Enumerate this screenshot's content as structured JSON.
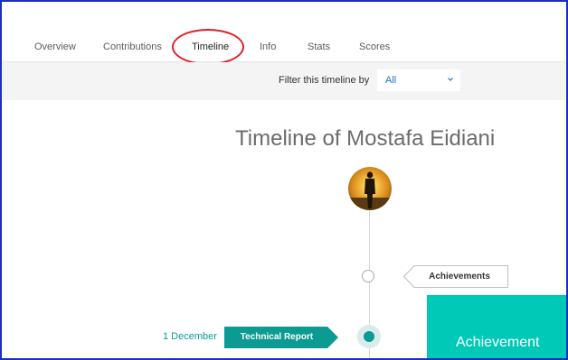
{
  "tabs": [
    {
      "label": "Overview"
    },
    {
      "label": "Contributions"
    },
    {
      "label": "Timeline"
    },
    {
      "label": "Info"
    },
    {
      "label": "Stats"
    },
    {
      "label": "Scores"
    }
  ],
  "filter": {
    "label": "Filter this timeline by",
    "selected": "All"
  },
  "title": "Timeline of Mostafa Eidiani",
  "timeline": {
    "achievement_label": "Achievements",
    "entry_date": "1 December",
    "entry_type": "Technical Report",
    "card_title": "Achievement"
  },
  "colors": {
    "teal": "#0b9b92",
    "card_teal": "#00c9b7",
    "link_blue": "#1a73c9",
    "frame_blue": "#1c2fc4",
    "annotation_red": "#e01f26"
  }
}
